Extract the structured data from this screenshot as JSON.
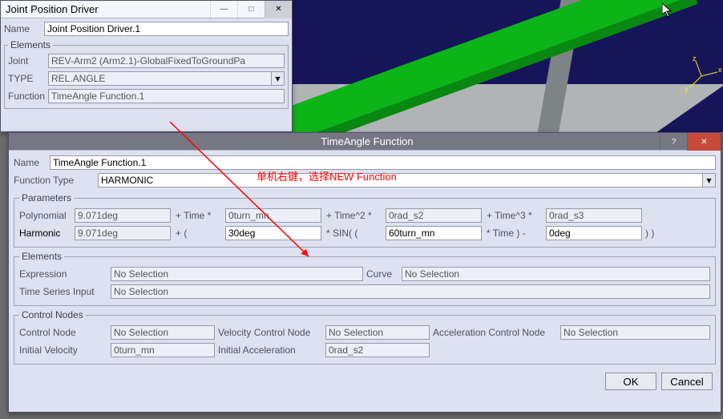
{
  "joint_window": {
    "title": "Joint Position Driver",
    "name_label": "Name",
    "name_value": "Joint Position Driver.1",
    "elements_legend": "Elements",
    "joint_label": "Joint",
    "joint_value": "REV-Arm2 (Arm2.1)-GlobalFixedToGroundPa",
    "type_label": "TYPE",
    "type_value": "REL.ANGLE",
    "function_label": "Function",
    "function_value": "TimeAngle Function.1"
  },
  "annotation_text": "单机右键，选择NEW Function",
  "ta_window": {
    "title": "TimeAngle Function",
    "name_label": "Name",
    "name_value": "TimeAngle Function.1",
    "ftype_label": "Function Type",
    "ftype_value": "HARMONIC",
    "params_legend": "Parameters",
    "poly": {
      "label": "Polynomial",
      "a0": "9.071deg",
      "t1_lbl": "+ Time *",
      "a1": "0turn_mn",
      "t2_lbl": "+ Time^2 *",
      "a2": "0rad_s2",
      "t3_lbl": "+ Time^3 *",
      "a3": "0rad_s3"
    },
    "harm": {
      "label": "Harmonic",
      "h0": "9.071deg",
      "plus_paren": "+ (",
      "h1": "30deg",
      "sin_lbl": "* SIN( (",
      "h2": "60turn_mn",
      "time_lbl": "* Time ) -",
      "h3": "0deg",
      "close": ") )"
    },
    "elements_legend": "Elements",
    "expr_label": "Expression",
    "expr_value": "No Selection",
    "curve_label": "Curve",
    "curve_value": "No Selection",
    "tsi_label": "Time Series Input",
    "tsi_value": "No Selection",
    "cn_legend": "Control Nodes",
    "cn_label": "Control Node",
    "cn_value": "No Selection",
    "vcn_label": "Velocity Control Node",
    "vcn_value": "No Selection",
    "acn_label": "Acceleration Control Node",
    "acn_value": "No Selection",
    "iv_label": "Initial Velocity",
    "iv_value": "0turn_mn",
    "ia_label": "Initial Acceleration",
    "ia_value": "0rad_s2",
    "ok": "OK",
    "cancel": "Cancel"
  }
}
